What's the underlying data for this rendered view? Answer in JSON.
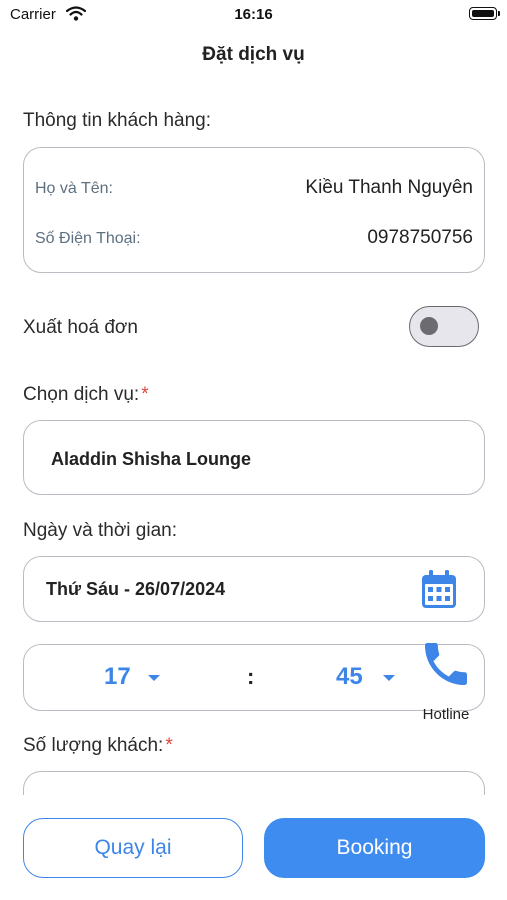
{
  "status_bar": {
    "carrier": "Carrier",
    "time": "16:16"
  },
  "nav": {
    "title": "Đặt dịch vụ"
  },
  "customer_info": {
    "section_label": "Thông tin khách hàng:",
    "name_label": "Họ và Tên:",
    "name_value": "Kiều Thanh Nguyên",
    "phone_label": "Số Điện Thoại:",
    "phone_value": "0978750756"
  },
  "invoice": {
    "label": "Xuất hoá đơn",
    "enabled": false
  },
  "service": {
    "label": "Chọn dịch vụ:",
    "required_mark": "*",
    "selected": "Aladdin Shisha Lounge"
  },
  "datetime": {
    "label": "Ngày và thời gian:",
    "date_value": "Thứ Sáu - 26/07/2024",
    "hour": "17",
    "separator": ":",
    "minute": "45"
  },
  "hotline": {
    "label": "Hotline"
  },
  "guests": {
    "label": "Số lượng khách:",
    "required_mark": "*"
  },
  "actions": {
    "back_label": "Quay lại",
    "booking_label": "Booking"
  },
  "colors": {
    "accent": "#3f8cf0",
    "required": "#e0463c",
    "border": "#b9bcc2"
  }
}
